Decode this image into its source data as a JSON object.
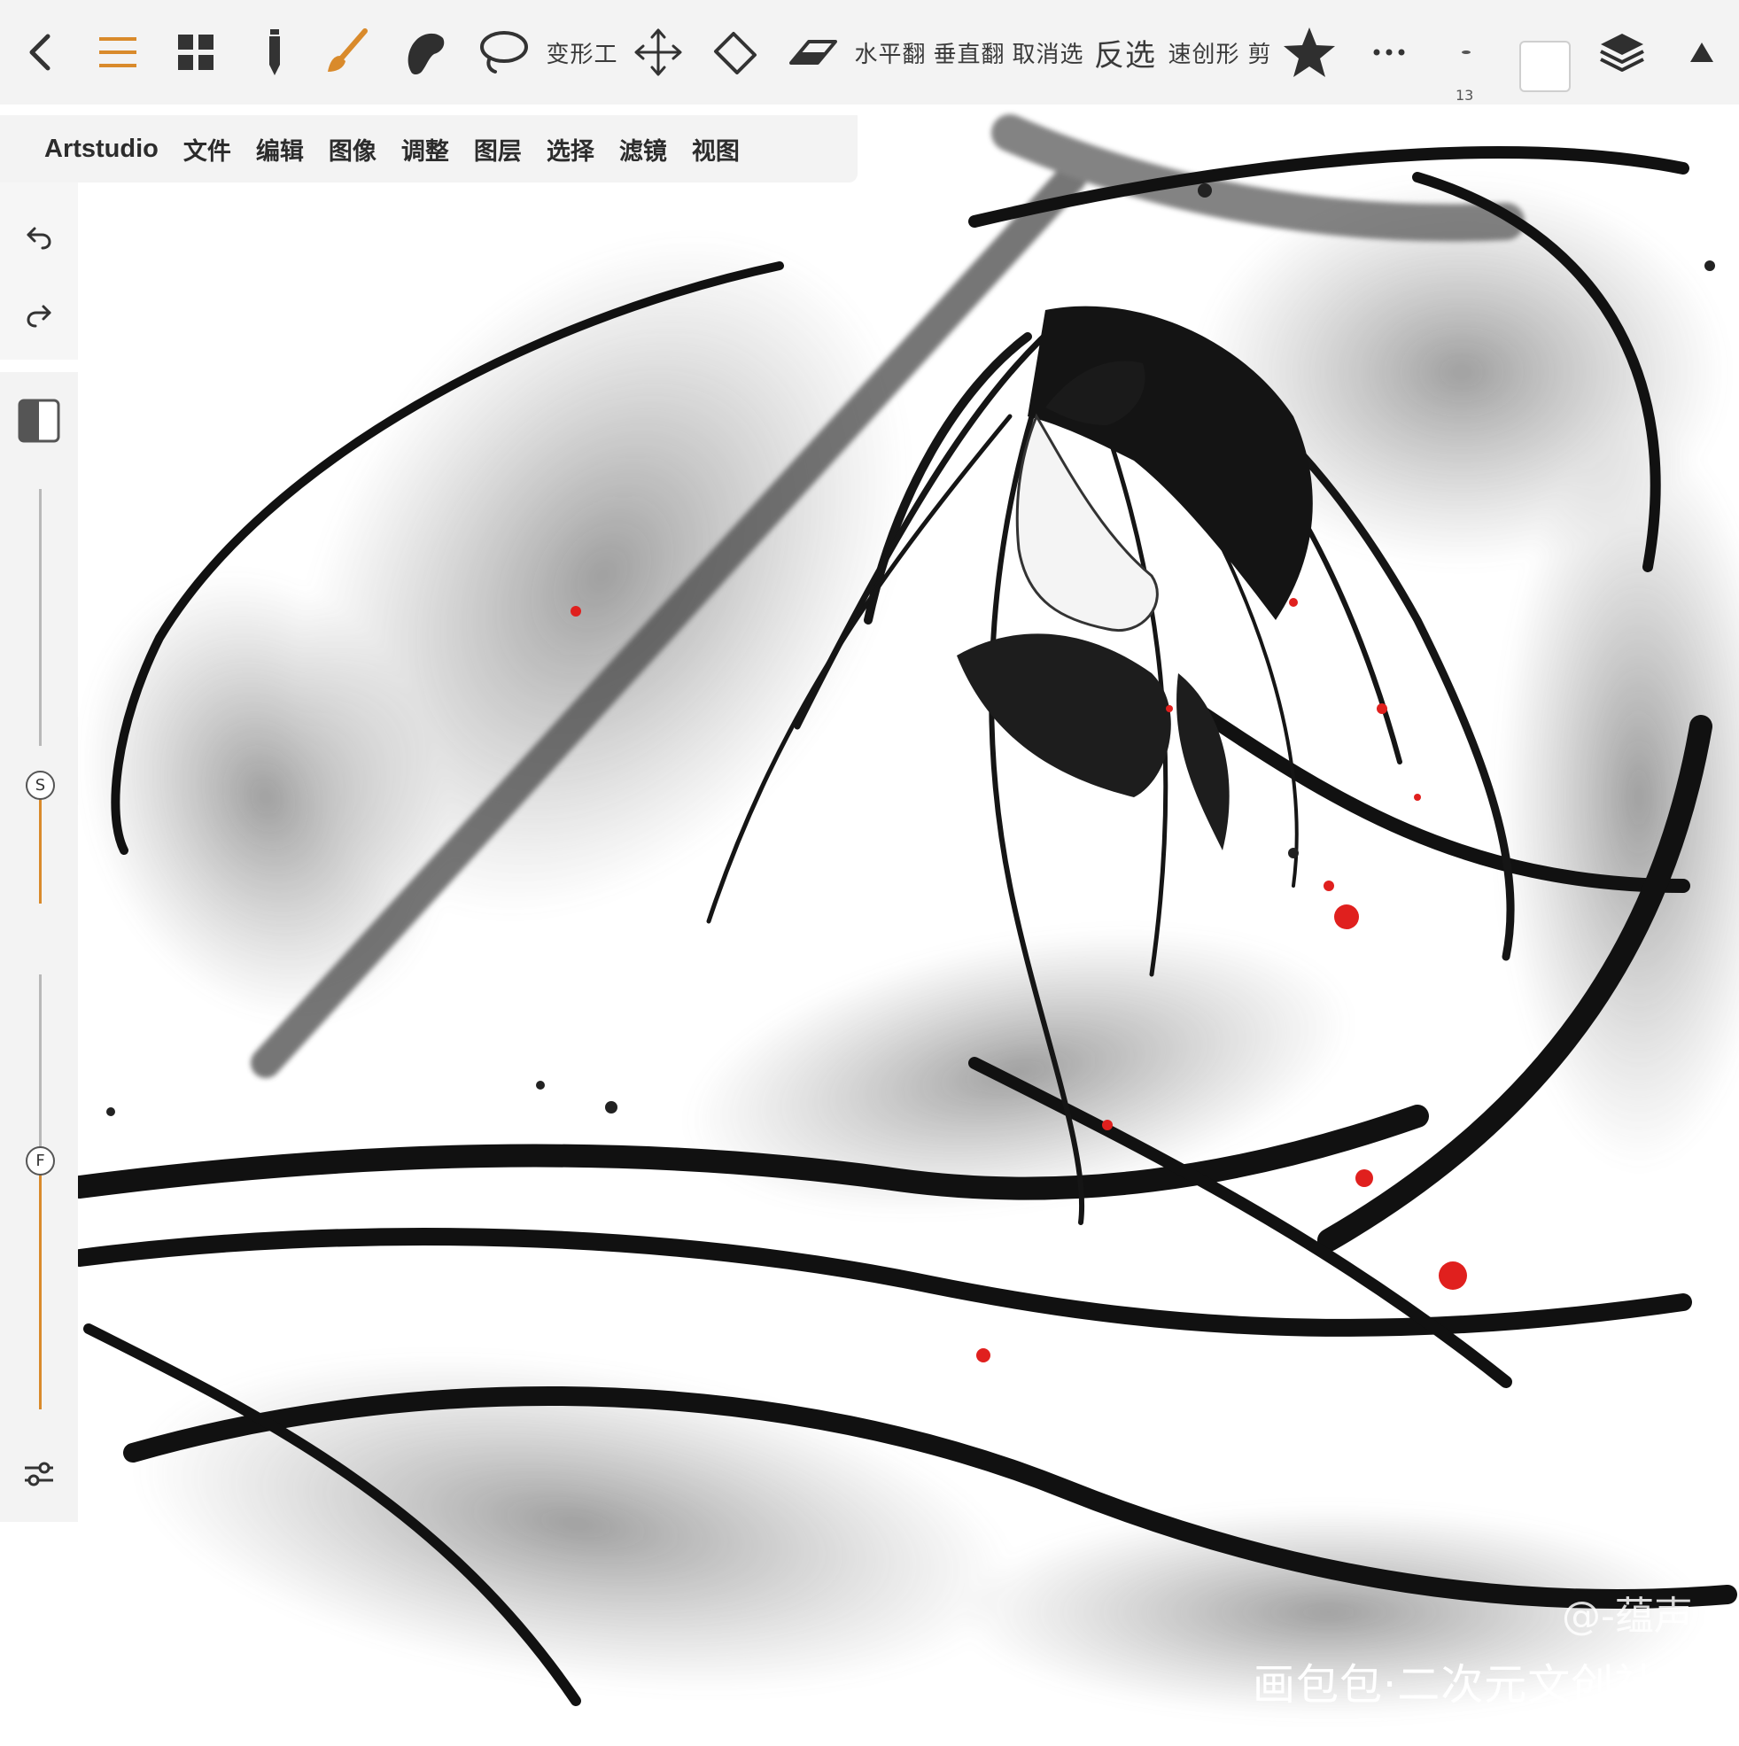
{
  "toolbar": {
    "back_icon": "chevron-left-icon",
    "menu_icon": "hamburger-icon",
    "grid_icon": "grid-icon",
    "pencil_icon": "pencil-icon",
    "brush_icon": "brush-icon",
    "smudge_icon": "smudge-icon",
    "lasso_icon": "lasso-icon",
    "transform_label": "变形工",
    "move_icon": "move-icon",
    "fill_icon": "fill-icon",
    "eraser_icon": "eraser-icon",
    "flip_h_label": "水平翻",
    "flip_v_label": "垂直翻",
    "deselect_label": "取消选",
    "invert_label": "反选",
    "quick_shape_label": "速创形",
    "cut_label": "剪",
    "favorite_icon": "star-icon",
    "more_icon": "more-icon",
    "brush_size": "13",
    "current_color": "#ffffff",
    "layers_icon": "layers-icon",
    "collapse_icon": "triangle-up-icon",
    "accent_color": "#d98a2b"
  },
  "menubar": {
    "items": [
      "Artstudio",
      "文件",
      "编辑",
      "图像",
      "调整",
      "图层",
      "选择",
      "滤镜",
      "视图"
    ]
  },
  "sidebar": {
    "undo_icon": "undo-icon",
    "redo_icon": "redo-icon",
    "compare_icon": "split-view-icon",
    "size_slider_label": "S",
    "size_slider_value": 0.32,
    "flow_slider_label": "F",
    "flow_slider_value": 0.58,
    "settings_icon": "sliders-icon"
  },
  "watermark": {
    "author": "@-蕴声",
    "site": "画包包·二次元文创社区"
  }
}
